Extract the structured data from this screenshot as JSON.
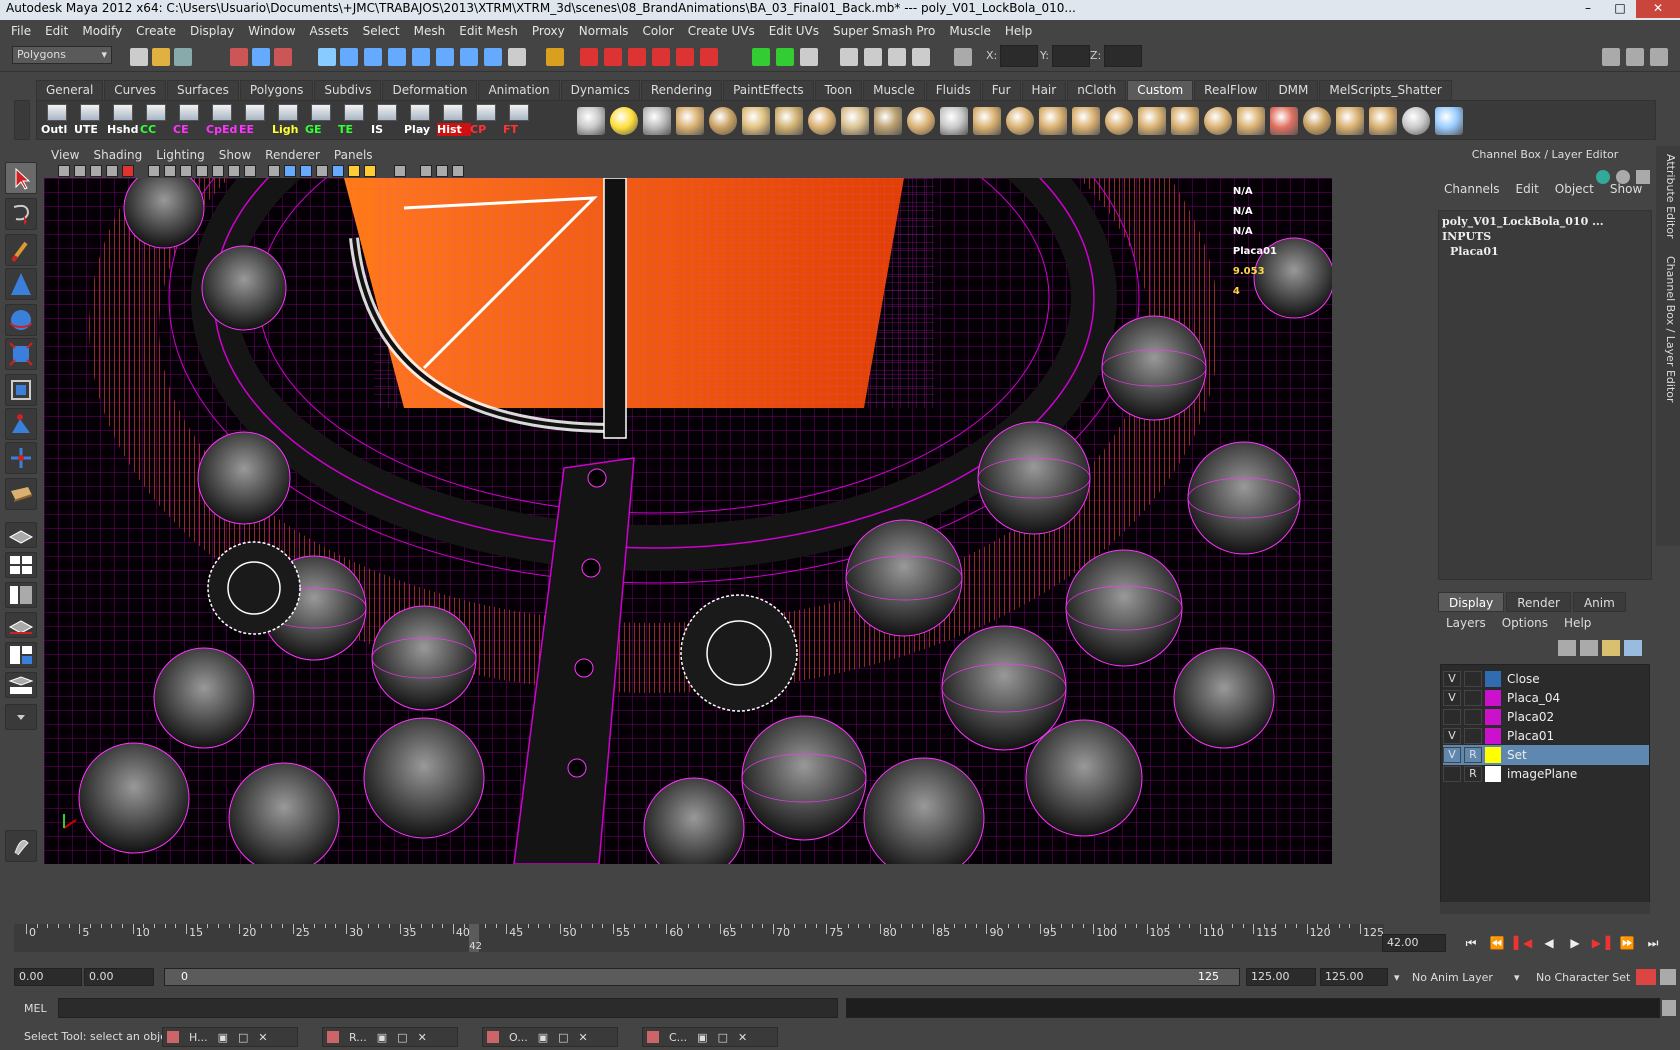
{
  "window": {
    "title": "Autodesk Maya 2012 x64: C:\\Users\\Usuario\\Documents\\+JMC\\TRABAJOS\\2013\\XTRM\\XTRM_3d\\scenes\\08_BrandAnimations\\BA_03_Final01_Back.mb*   ---   poly_V01_LockBola_010...",
    "minimize": "–",
    "maximize": "□",
    "close": "✕"
  },
  "menu": [
    "File",
    "Edit",
    "Modify",
    "Create",
    "Display",
    "Window",
    "Assets",
    "Select",
    "Mesh",
    "Edit Mesh",
    "Proxy",
    "Normals",
    "Color",
    "Create UVs",
    "Edit UVs",
    "Super Smash Pro",
    "Muscle",
    "Help"
  ],
  "status_line": {
    "mode": "Polygons",
    "x_label": "X:",
    "y_label": "Y:",
    "z_label": "Z:"
  },
  "shelf_tabs": [
    "General",
    "Curves",
    "Surfaces",
    "Polygons",
    "Subdivs",
    "Deformation",
    "Animation",
    "Dynamics",
    "Rendering",
    "PaintEffects",
    "Toon",
    "Muscle",
    "Fluids",
    "Fur",
    "Hair",
    "nCloth",
    "Custom",
    "RealFlow",
    "DMM",
    "MelScripts_Shatter"
  ],
  "active_shelf_tab": "Custom",
  "shelf_buttons": [
    {
      "label": "Outl",
      "color": "#ffffff"
    },
    {
      "label": "UTE",
      "color": "#ffffff"
    },
    {
      "label": "Hshd",
      "color": "#ffffff"
    },
    {
      "label": "CC",
      "color": "#33ff33"
    },
    {
      "label": "CE",
      "color": "#ff33ff"
    },
    {
      "label": "CpEd",
      "color": "#ff33ff"
    },
    {
      "label": "EE",
      "color": "#ff33ff"
    },
    {
      "label": "Ligh",
      "color": "#ffff33"
    },
    {
      "label": "GE",
      "color": "#33ff33"
    },
    {
      "label": "TE",
      "color": "#33ff33"
    },
    {
      "label": "IS",
      "color": "#ffffff"
    },
    {
      "label": "Play",
      "color": "#ffffff"
    },
    {
      "label": "Hist",
      "color": "#ffffff",
      "bg": "#cc1111"
    },
    {
      "label": "CP",
      "color": "#ff3333"
    },
    {
      "label": "FT",
      "color": "#ff3333"
    }
  ],
  "panel_menu": [
    "View",
    "Shading",
    "Lighting",
    "Show",
    "Renderer",
    "Panels"
  ],
  "hud": {
    "values": [
      "N/A",
      "N/A",
      "N/A",
      "Placa01",
      "9.053",
      "4"
    ]
  },
  "channel_box": {
    "title": "Channel Box / Layer Editor",
    "menu": [
      "Channels",
      "Edit",
      "Object",
      "Show"
    ],
    "object": "poly_V01_LockBola_010 ...",
    "inputs_label": "INPUTS",
    "input_node": "Placa01"
  },
  "layer_editor": {
    "tabs": [
      "Display",
      "Render",
      "Anim"
    ],
    "active_tab": "Display",
    "menu": [
      "Layers",
      "Options",
      "Help"
    ],
    "layers": [
      {
        "v": "V",
        "r": "",
        "color": "#2f6db0",
        "name": "Close"
      },
      {
        "v": "V",
        "r": "",
        "color": "#cc11cc",
        "name": "Placa_04"
      },
      {
        "v": "",
        "r": "",
        "color": "#cc11cc",
        "name": "Placa02"
      },
      {
        "v": "V",
        "r": "",
        "color": "#cc11cc",
        "name": "Placa01"
      },
      {
        "v": "V",
        "r": "R",
        "color": "#ffff00",
        "name": "Set",
        "selected": true
      },
      {
        "v": "",
        "r": "R",
        "color": "#ffffff",
        "name": "imagePlane"
      }
    ]
  },
  "side_tabs": [
    "Attribute Editor",
    "Channel Box / Layer Editor"
  ],
  "timeline": {
    "ticks": [
      0,
      5,
      10,
      15,
      20,
      25,
      30,
      35,
      40,
      45,
      50,
      55,
      60,
      65,
      70,
      75,
      80,
      85,
      90,
      95,
      100,
      105,
      110,
      115,
      120,
      125
    ],
    "current": 42,
    "current_label": "42",
    "current_field": "42.00"
  },
  "range": {
    "start": "0.00",
    "playback_start": "0.00",
    "slider_start": "0",
    "slider_end": "125",
    "playback_end": "125.00",
    "end": "125.00",
    "anim_layer": "No Anim Layer",
    "character_set": "No Character Set"
  },
  "command": {
    "label": "MEL"
  },
  "help_line": "Select Tool: select an object",
  "taskbar": [
    {
      "label": "H..."
    },
    {
      "label": "R..."
    },
    {
      "label": "O..."
    },
    {
      "label": "C..."
    }
  ]
}
